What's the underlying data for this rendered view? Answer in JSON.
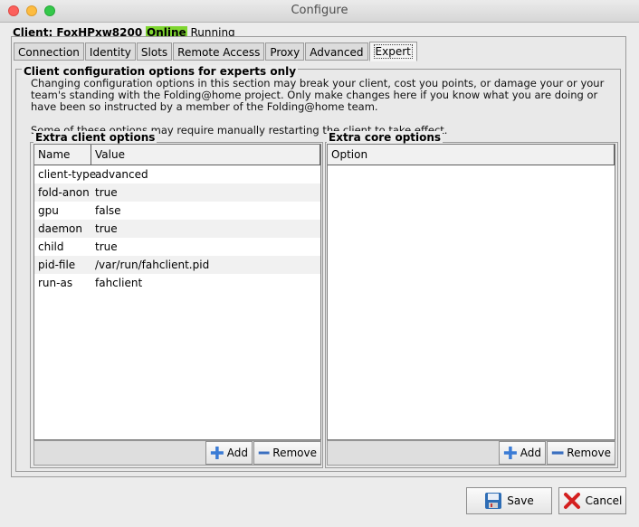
{
  "window": {
    "title": "Configure"
  },
  "client": {
    "label": "Client: FoxHPxw8200",
    "status": "Online",
    "state": "Running"
  },
  "tabs": [
    {
      "label": "Connection",
      "active": false
    },
    {
      "label": "Identity",
      "active": false
    },
    {
      "label": "Slots",
      "active": false
    },
    {
      "label": "Remote Access",
      "active": false
    },
    {
      "label": "Proxy",
      "active": false
    },
    {
      "label": "Advanced",
      "active": false
    },
    {
      "label": "Expert",
      "active": true
    }
  ],
  "expert": {
    "group_title": "Client configuration options for experts only",
    "warning": "Changing configuration options in this section may break your client, cost you points, or damage your or your team's standing with the Folding@home project.  Only make changes here if you know what you are doing or have been so instructed by a member of the Folding@home team.",
    "restart_note": "Some of these options may require manually restarting the client to take effect."
  },
  "client_options": {
    "title": "Extra client options",
    "columns": [
      "Name",
      "Value"
    ],
    "rows": [
      {
        "name": "client-type",
        "value": "advanced"
      },
      {
        "name": "fold-anon",
        "value": "true"
      },
      {
        "name": "gpu",
        "value": "false"
      },
      {
        "name": "daemon",
        "value": "true"
      },
      {
        "name": "child",
        "value": "true"
      },
      {
        "name": "pid-file",
        "value": "/var/run/fahclient.pid"
      },
      {
        "name": "run-as",
        "value": "fahclient"
      }
    ],
    "add_label": "Add",
    "remove_label": "Remove"
  },
  "core_options": {
    "title": "Extra core options",
    "columns": [
      "Option"
    ],
    "add_label": "Add",
    "remove_label": "Remove"
  },
  "footer": {
    "save_label": "Save",
    "cancel_label": "Cancel"
  },
  "colors": {
    "online_badge": "#7fd630",
    "add_icon": "#3a7bd5",
    "remove_icon": "#3a6fc0",
    "cancel_icon": "#d42020"
  }
}
